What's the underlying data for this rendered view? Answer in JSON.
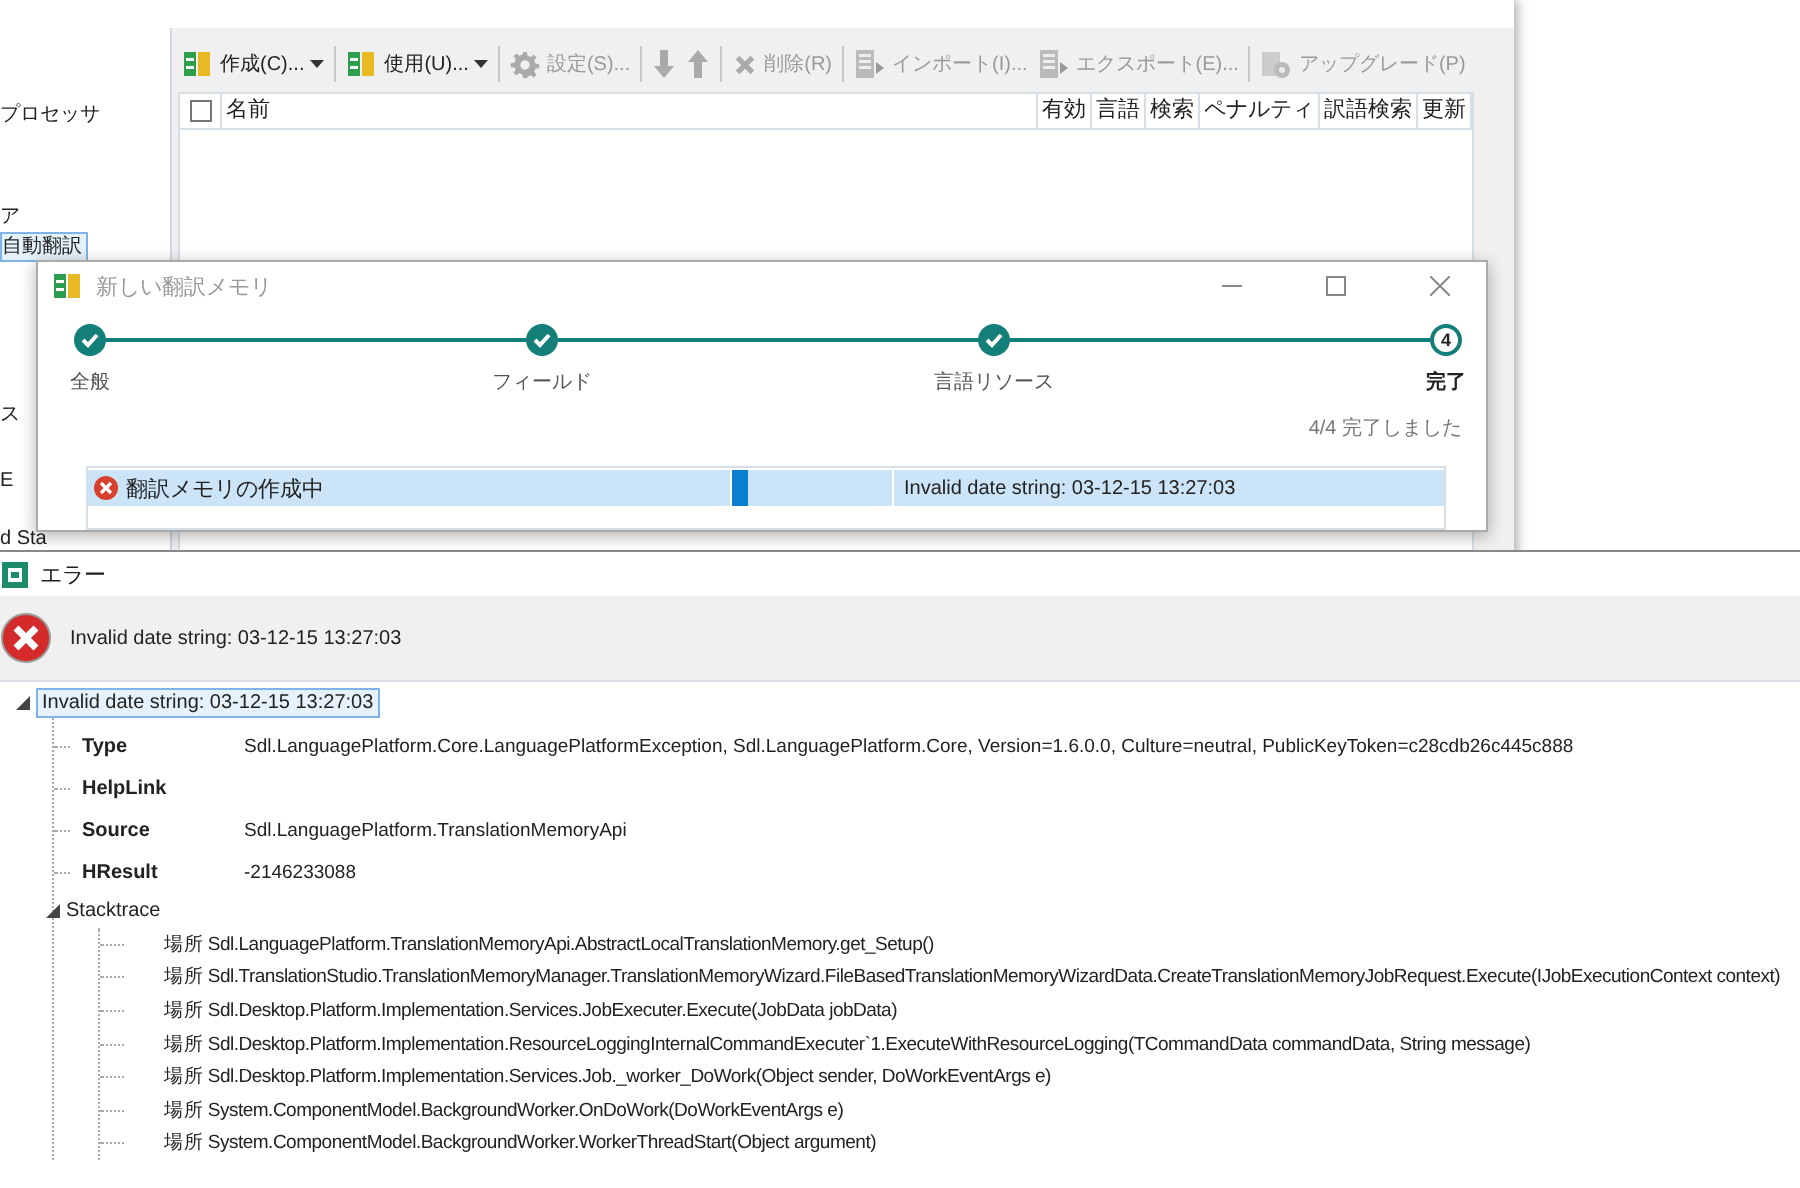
{
  "main_window": {
    "sidebar": {
      "items": [
        {
          "label": "プロセッサ",
          "selected": false
        },
        {
          "label": "ア",
          "selected": false
        },
        {
          "label": "自動翻訳",
          "selected": true
        },
        {
          "label": "ス",
          "selected": false
        },
        {
          "label": "E",
          "selected": false
        },
        {
          "label": "d Sta",
          "selected": false
        }
      ]
    },
    "toolbar": [
      {
        "kind": "split",
        "label": "作成(C)...",
        "disabled": false
      },
      {
        "kind": "separator"
      },
      {
        "kind": "split",
        "label": "使用(U)...",
        "disabled": false
      },
      {
        "kind": "separator"
      },
      {
        "kind": "button",
        "label": "設定(S)...",
        "disabled": true
      },
      {
        "kind": "separator"
      },
      {
        "kind": "icon",
        "disabled": true
      },
      {
        "kind": "icon",
        "disabled": true
      },
      {
        "kind": "separator"
      },
      {
        "kind": "button",
        "label": "削除(R)",
        "disabled": true
      },
      {
        "kind": "separator"
      },
      {
        "kind": "button",
        "label": "インポート(I)...",
        "disabled": true
      },
      {
        "kind": "button",
        "label": "エクスポート(E)...",
        "disabled": true
      },
      {
        "kind": "separator"
      },
      {
        "kind": "button",
        "label": "アップグレード(P)",
        "disabled": true
      }
    ],
    "table": {
      "checkbox_checked": false,
      "columns": [
        "名前",
        "有効",
        "言語",
        "検索",
        "ペナルティ",
        "訳語検索",
        "更新"
      ]
    }
  },
  "wizard": {
    "title": "新しい翻訳メモリ",
    "steps": [
      {
        "label": "全般",
        "done": true,
        "selected": false
      },
      {
        "label": "フィールド",
        "done": true,
        "selected": false
      },
      {
        "label": "言語リソース",
        "done": true,
        "selected": false
      },
      {
        "label": "完了",
        "number": "4",
        "done": false,
        "selected": true
      }
    ],
    "status": "4/4 完了しました",
    "tasks": [
      {
        "name": "翻訳メモリの作成中",
        "kind": "error",
        "level": 0.1,
        "message": "Invalid date string: 03-12-15 13:27:03",
        "selected": true
      }
    ]
  },
  "error_window": {
    "title": "エラー",
    "message": "Invalid date string: 03-12-15 13:27:03",
    "tree": {
      "label": "Invalid date string: 03-12-15 13:27:03",
      "expanded": true,
      "selected": true,
      "children": [
        {
          "kind": "property",
          "name": "Type",
          "value": "Sdl.LanguagePlatform.Core.LanguagePlatformException, Sdl.LanguagePlatform.Core, Version=1.6.0.0, Culture=neutral, PublicKeyToken=c28cdb26c445c888"
        },
        {
          "kind": "property",
          "name": "HelpLink"
        },
        {
          "kind": "property",
          "name": "Source",
          "value": "Sdl.LanguagePlatform.TranslationMemoryApi"
        },
        {
          "kind": "property",
          "name": "HResult",
          "value": "-2146233088"
        },
        {
          "kind": "node",
          "label": "Stacktrace",
          "expanded": true,
          "children": [
            {
              "kind": "line",
              "text": "場所 Sdl.LanguagePlatform.TranslationMemoryApi.AbstractLocalTranslationMemory.get_Setup()"
            },
            {
              "kind": "line",
              "text": "場所 Sdl.TranslationStudio.TranslationMemoryManager.TranslationMemoryWizard.FileBasedTranslationMemoryWizardData.CreateTranslationMemoryJobRequest.Execute(IJobExecutionContext context)"
            },
            {
              "kind": "line",
              "text": "場所 Sdl.Desktop.Platform.Implementation.Services.JobExecuter.Execute(JobData jobData)"
            },
            {
              "kind": "line",
              "text": "場所 Sdl.Desktop.Platform.Implementation.ResourceLoggingInternalCommandExecuter`1.ExecuteWithResourceLogging(TCommandData commandData, String message)"
            },
            {
              "kind": "line",
              "text": "場所 Sdl.Desktop.Platform.Implementation.Services.Job._worker_DoWork(Object sender, DoWorkEventArgs e)"
            },
            {
              "kind": "line",
              "text": "場所 System.ComponentModel.BackgroundWorker.OnDoWork(DoWorkEventArgs e)"
            },
            {
              "kind": "line",
              "text": "場所 System.ComponentModel.BackgroundWorker.WorkerThreadStart(Object argument)"
            }
          ]
        }
      ]
    }
  }
}
